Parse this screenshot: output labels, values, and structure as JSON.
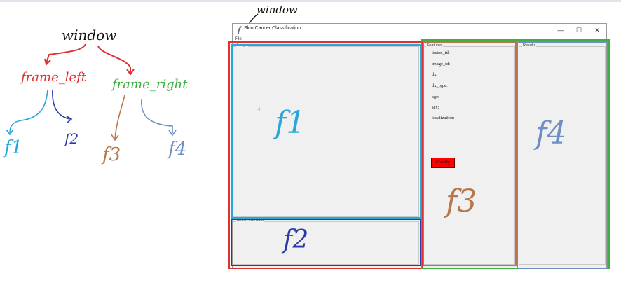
{
  "annotations": {
    "window_top": "window",
    "window_tree": "window",
    "frame_left": "frame_left",
    "frame_right": "frame_right",
    "tree_f1": "f1",
    "tree_f2": "f2",
    "tree_f3": "f3",
    "tree_f4": "f4",
    "big_f1": "f1",
    "big_f2": "f2",
    "big_f3": "f3",
    "big_f4": "f4"
  },
  "window": {
    "title": "Skin Cancer Classification",
    "menu_file": "File",
    "minimize": "—",
    "maximize": "☐",
    "close": "✕"
  },
  "frames": {
    "image_label": "Image",
    "model_label": "Model and data",
    "features_label": "Features",
    "results_label": "Results"
  },
  "features": [
    "lesion_id:",
    "image_id:",
    "dx:",
    "dx_type:",
    "age:",
    "sex:",
    "localization:"
  ],
  "classify_label": "Classify",
  "colors": {
    "red": "#e03030",
    "cyan": "#2ba6d8",
    "navy": "#2b3aa8",
    "brown": "#b8764a",
    "steel": "#6f8fc4",
    "green": "#3cb043"
  }
}
